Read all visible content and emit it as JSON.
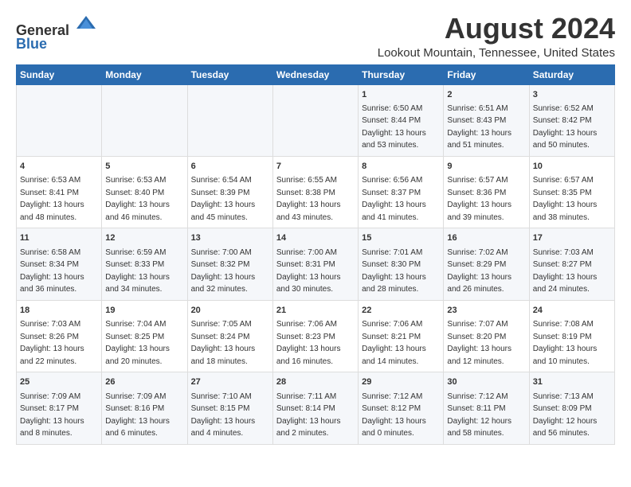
{
  "logo": {
    "text1": "General",
    "text2": "Blue"
  },
  "title": "August 2024",
  "subtitle": "Lookout Mountain, Tennessee, United States",
  "days_of_week": [
    "Sunday",
    "Monday",
    "Tuesday",
    "Wednesday",
    "Thursday",
    "Friday",
    "Saturday"
  ],
  "weeks": [
    [
      {
        "day": "",
        "content": ""
      },
      {
        "day": "",
        "content": ""
      },
      {
        "day": "",
        "content": ""
      },
      {
        "day": "",
        "content": ""
      },
      {
        "day": "1",
        "content": "Sunrise: 6:50 AM\nSunset: 8:44 PM\nDaylight: 13 hours\nand 53 minutes."
      },
      {
        "day": "2",
        "content": "Sunrise: 6:51 AM\nSunset: 8:43 PM\nDaylight: 13 hours\nand 51 minutes."
      },
      {
        "day": "3",
        "content": "Sunrise: 6:52 AM\nSunset: 8:42 PM\nDaylight: 13 hours\nand 50 minutes."
      }
    ],
    [
      {
        "day": "4",
        "content": "Sunrise: 6:53 AM\nSunset: 8:41 PM\nDaylight: 13 hours\nand 48 minutes."
      },
      {
        "day": "5",
        "content": "Sunrise: 6:53 AM\nSunset: 8:40 PM\nDaylight: 13 hours\nand 46 minutes."
      },
      {
        "day": "6",
        "content": "Sunrise: 6:54 AM\nSunset: 8:39 PM\nDaylight: 13 hours\nand 45 minutes."
      },
      {
        "day": "7",
        "content": "Sunrise: 6:55 AM\nSunset: 8:38 PM\nDaylight: 13 hours\nand 43 minutes."
      },
      {
        "day": "8",
        "content": "Sunrise: 6:56 AM\nSunset: 8:37 PM\nDaylight: 13 hours\nand 41 minutes."
      },
      {
        "day": "9",
        "content": "Sunrise: 6:57 AM\nSunset: 8:36 PM\nDaylight: 13 hours\nand 39 minutes."
      },
      {
        "day": "10",
        "content": "Sunrise: 6:57 AM\nSunset: 8:35 PM\nDaylight: 13 hours\nand 38 minutes."
      }
    ],
    [
      {
        "day": "11",
        "content": "Sunrise: 6:58 AM\nSunset: 8:34 PM\nDaylight: 13 hours\nand 36 minutes."
      },
      {
        "day": "12",
        "content": "Sunrise: 6:59 AM\nSunset: 8:33 PM\nDaylight: 13 hours\nand 34 minutes."
      },
      {
        "day": "13",
        "content": "Sunrise: 7:00 AM\nSunset: 8:32 PM\nDaylight: 13 hours\nand 32 minutes."
      },
      {
        "day": "14",
        "content": "Sunrise: 7:00 AM\nSunset: 8:31 PM\nDaylight: 13 hours\nand 30 minutes."
      },
      {
        "day": "15",
        "content": "Sunrise: 7:01 AM\nSunset: 8:30 PM\nDaylight: 13 hours\nand 28 minutes."
      },
      {
        "day": "16",
        "content": "Sunrise: 7:02 AM\nSunset: 8:29 PM\nDaylight: 13 hours\nand 26 minutes."
      },
      {
        "day": "17",
        "content": "Sunrise: 7:03 AM\nSunset: 8:27 PM\nDaylight: 13 hours\nand 24 minutes."
      }
    ],
    [
      {
        "day": "18",
        "content": "Sunrise: 7:03 AM\nSunset: 8:26 PM\nDaylight: 13 hours\nand 22 minutes."
      },
      {
        "day": "19",
        "content": "Sunrise: 7:04 AM\nSunset: 8:25 PM\nDaylight: 13 hours\nand 20 minutes."
      },
      {
        "day": "20",
        "content": "Sunrise: 7:05 AM\nSunset: 8:24 PM\nDaylight: 13 hours\nand 18 minutes."
      },
      {
        "day": "21",
        "content": "Sunrise: 7:06 AM\nSunset: 8:23 PM\nDaylight: 13 hours\nand 16 minutes."
      },
      {
        "day": "22",
        "content": "Sunrise: 7:06 AM\nSunset: 8:21 PM\nDaylight: 13 hours\nand 14 minutes."
      },
      {
        "day": "23",
        "content": "Sunrise: 7:07 AM\nSunset: 8:20 PM\nDaylight: 13 hours\nand 12 minutes."
      },
      {
        "day": "24",
        "content": "Sunrise: 7:08 AM\nSunset: 8:19 PM\nDaylight: 13 hours\nand 10 minutes."
      }
    ],
    [
      {
        "day": "25",
        "content": "Sunrise: 7:09 AM\nSunset: 8:17 PM\nDaylight: 13 hours\nand 8 minutes."
      },
      {
        "day": "26",
        "content": "Sunrise: 7:09 AM\nSunset: 8:16 PM\nDaylight: 13 hours\nand 6 minutes."
      },
      {
        "day": "27",
        "content": "Sunrise: 7:10 AM\nSunset: 8:15 PM\nDaylight: 13 hours\nand 4 minutes."
      },
      {
        "day": "28",
        "content": "Sunrise: 7:11 AM\nSunset: 8:14 PM\nDaylight: 13 hours\nand 2 minutes."
      },
      {
        "day": "29",
        "content": "Sunrise: 7:12 AM\nSunset: 8:12 PM\nDaylight: 13 hours\nand 0 minutes."
      },
      {
        "day": "30",
        "content": "Sunrise: 7:12 AM\nSunset: 8:11 PM\nDaylight: 12 hours\nand 58 minutes."
      },
      {
        "day": "31",
        "content": "Sunrise: 7:13 AM\nSunset: 8:09 PM\nDaylight: 12 hours\nand 56 minutes."
      }
    ]
  ]
}
